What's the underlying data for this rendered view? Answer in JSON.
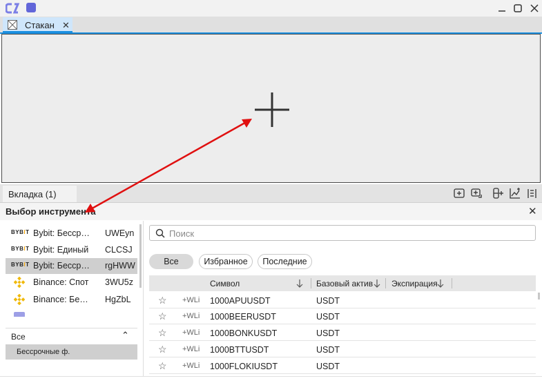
{
  "tab": {
    "label": "Стакан",
    "close": "✕"
  },
  "bottom_tab": {
    "label": "Вкладка (1)"
  },
  "panel": {
    "title": "Выбор инструмента",
    "close": "✕"
  },
  "accounts": [
    {
      "logo": "BYBIT",
      "name": "Bybit: Бессрочные",
      "code": "UWEyn",
      "selected": false
    },
    {
      "logo": "BYBIT",
      "name": "Bybit: Единый",
      "code": "CLCSJ",
      "selected": false
    },
    {
      "logo": "BYBIT",
      "name": "Bybit: Бессрочные",
      "code": "rgHWW",
      "selected": true
    },
    {
      "logo": "binance-icon",
      "name": "Binance: Спот",
      "code": "3WU5z",
      "selected": false
    },
    {
      "logo": "binance-icon",
      "name": "Binance: Бессрочные",
      "code": "HgZbL",
      "selected": false
    }
  ],
  "categories": {
    "title": "Все",
    "chevron": "⌃",
    "selected_item": "Бессрочные ф."
  },
  "search": {
    "placeholder": "Поиск",
    "value": ""
  },
  "filters": [
    "Все",
    "Избранное",
    "Последние"
  ],
  "table": {
    "columns": [
      "Символ",
      "Базовый актив",
      "Экспирация"
    ],
    "wl_label": "+WLi",
    "rows": [
      {
        "symbol": "1000APUUSDT",
        "base": "USDT"
      },
      {
        "symbol": "1000BEERUSDT",
        "base": "USDT"
      },
      {
        "symbol": "1000BONKUSDT",
        "base": "USDT"
      },
      {
        "symbol": "1000BTTUSDT",
        "base": "USDT"
      },
      {
        "symbol": "1000FLOKIUSDT",
        "base": "USDT"
      }
    ]
  },
  "colors": {
    "accent": "#1a8fe0",
    "tab_bg": "#cfe6fb",
    "annotation_arrow": "#e01010",
    "binance": "#f0b90b",
    "logo": "#5b5fd6"
  }
}
